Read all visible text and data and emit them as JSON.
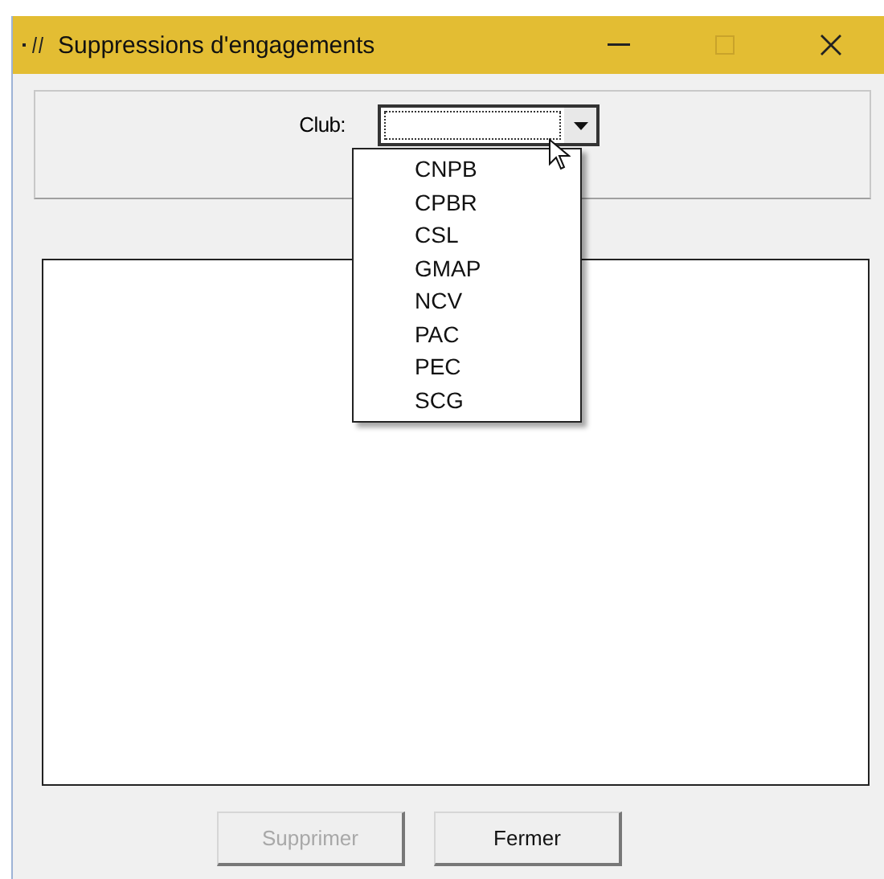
{
  "window": {
    "title": "Suppressions d'engagements"
  },
  "club": {
    "label": "Club:",
    "expanded": true,
    "options": [
      {
        "label": "CNPB",
        "selected": false
      },
      {
        "label": "CPBR",
        "selected": false
      },
      {
        "label": "CSL",
        "selected": false
      },
      {
        "label": "GMAP",
        "selected": false
      },
      {
        "label": "NCV",
        "selected": false
      },
      {
        "label": "PAC",
        "selected": false
      },
      {
        "label": "PEC",
        "selected": false
      },
      {
        "label": "SCG",
        "selected": false
      }
    ]
  },
  "buttons": [
    {
      "label": "Supprimer",
      "disabled": true
    },
    {
      "label": "Fermer",
      "disabled": false
    }
  ]
}
